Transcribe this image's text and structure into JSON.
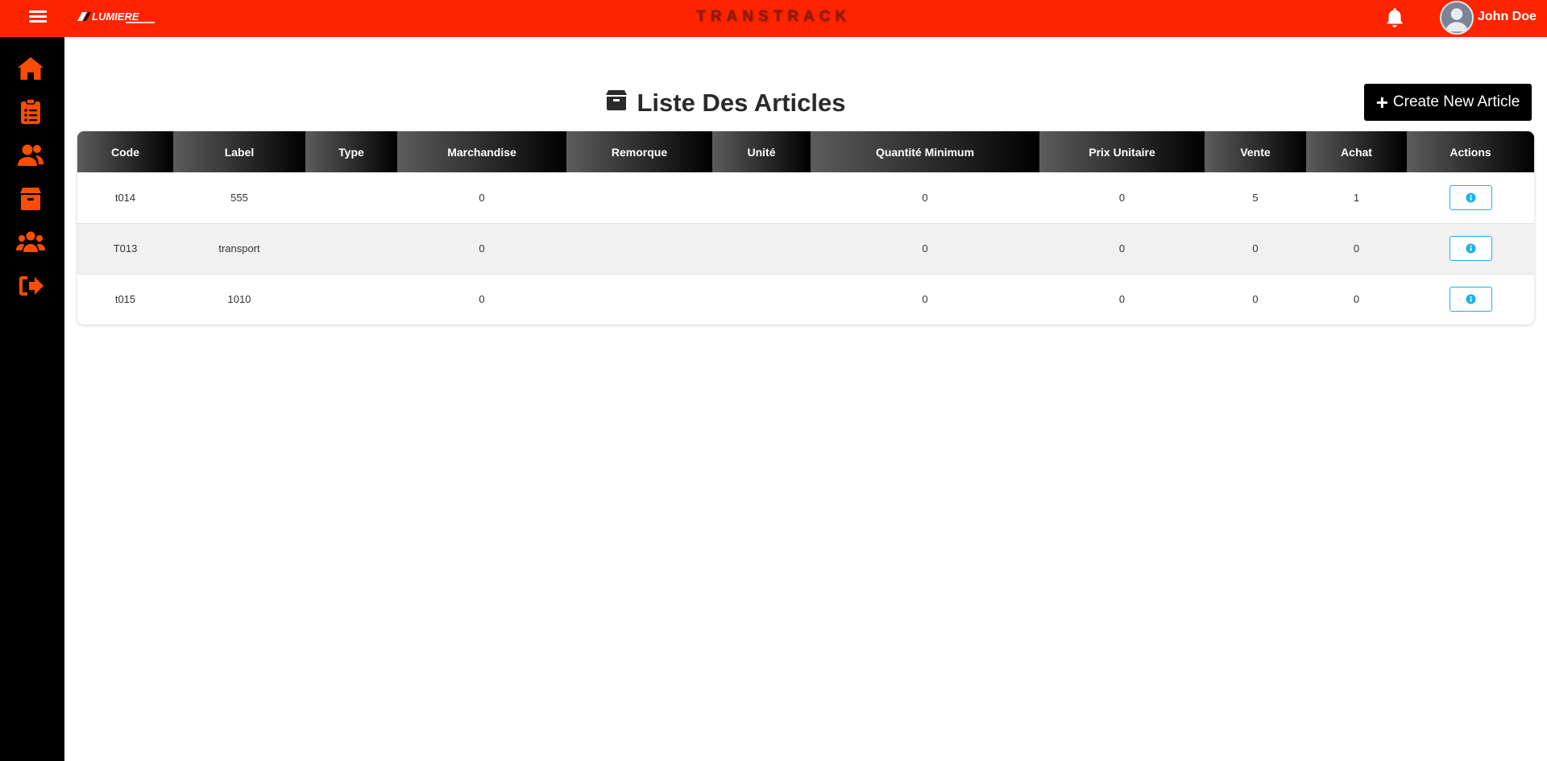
{
  "header": {
    "app_title": "TRANSTRACK",
    "username": "John Doe",
    "accent_color": "#ff2400",
    "icons": [
      "menu-icon",
      "logo",
      "bell-icon",
      "avatar"
    ]
  },
  "sidebar": {
    "icon_color": "#ff4d00",
    "items": [
      {
        "icon": "home-icon"
      },
      {
        "icon": "clipboard-list-icon"
      },
      {
        "icon": "users-icon"
      },
      {
        "icon": "box-icon"
      },
      {
        "icon": "group-icon"
      },
      {
        "icon": "sign-out-icon"
      }
    ]
  },
  "page": {
    "title": "Liste Des Articles",
    "title_icon": "box-icon",
    "create_button": "Create New Article"
  },
  "table": {
    "columns": [
      "Code",
      "Label",
      "Type",
      "Marchandise",
      "Remorque",
      "Unité",
      "Quantité Minimum",
      "Prix Unitaire",
      "Vente",
      "Achat",
      "Actions"
    ],
    "rows": [
      [
        "t014",
        "555",
        "",
        "0",
        "",
        "",
        "0",
        "0",
        "5",
        "1",
        ""
      ],
      [
        "T013",
        "transport",
        "",
        "0",
        "",
        "",
        "0",
        "0",
        "0",
        "0",
        ""
      ],
      [
        "t015",
        "1010",
        "",
        "0",
        "",
        "",
        "0",
        "0",
        "0",
        "0",
        ""
      ]
    ],
    "action_icon": "info-icon",
    "action_color": "#1ab3e6"
  }
}
